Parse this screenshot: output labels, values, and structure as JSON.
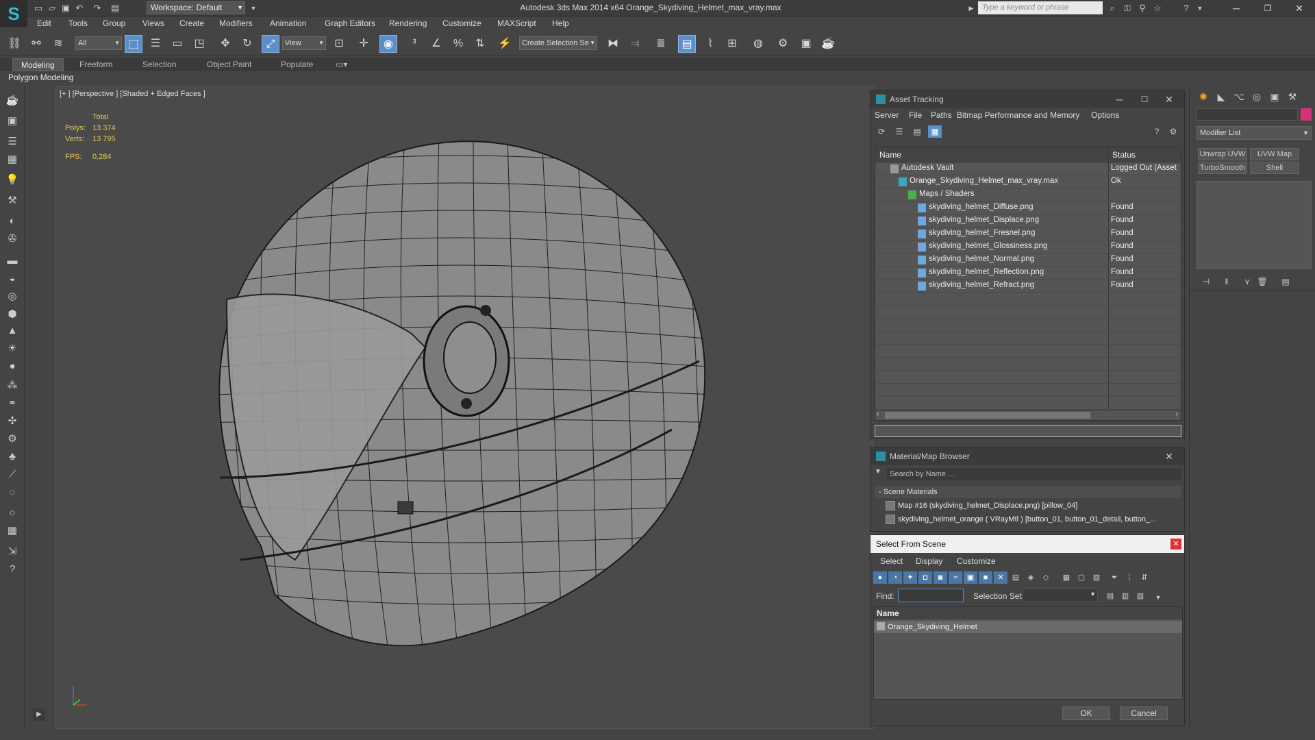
{
  "title": "Autodesk 3ds Max  2014 x64    Orange_Skydiving_Helmet_max_vray.max",
  "workspace": "Workspace: Default",
  "search_placeholder": "Type a keyword or phrase",
  "menu": [
    "Edit",
    "Tools",
    "Group",
    "Views",
    "Create",
    "Modifiers",
    "Animation",
    "Graph Editors",
    "Rendering",
    "Customize",
    "MAXScript",
    "Help"
  ],
  "toolbar": {
    "filter": "All",
    "refcoord": "View",
    "selset": "Create Selection Se"
  },
  "ribbon": {
    "tabs": [
      "Modeling",
      "Freeform",
      "Selection",
      "Object Paint",
      "Populate"
    ],
    "panel": "Polygon Modeling"
  },
  "viewport": {
    "label": "[+ ] [Perspective ] [Shaded + Edged Faces ]",
    "stats": {
      "total_label": "Total",
      "polys_label": "Polys:",
      "polys": "13 374",
      "verts_label": "Verts:",
      "verts": "13 795",
      "fps_label": "FPS:",
      "fps": "0,284"
    }
  },
  "asset_tracking": {
    "title": "Asset Tracking",
    "menu": [
      "Server",
      "File",
      "Paths",
      "Bitmap Performance and Memory",
      "Options"
    ],
    "columns": [
      "Name",
      "Status"
    ],
    "rows": [
      {
        "name": "Autodesk Vault",
        "status": "Logged Out (Asset"
      },
      {
        "name": "Orange_Skydiving_Helmet_max_vray.max",
        "status": "Ok"
      },
      {
        "name": "Maps / Shaders",
        "status": ""
      },
      {
        "name": "skydiving_helmet_Diffuse.png",
        "status": "Found"
      },
      {
        "name": "skydiving_helmet_Displace.png",
        "status": "Found"
      },
      {
        "name": "skydiving_helmet_Fresnel.png",
        "status": "Found"
      },
      {
        "name": "skydiving_helmet_Glossiness.png",
        "status": "Found"
      },
      {
        "name": "skydiving_helmet_Normal.png",
        "status": "Found"
      },
      {
        "name": "skydiving_helmet_Reflection.png",
        "status": "Found"
      },
      {
        "name": "skydiving_helmet_Refract.png",
        "status": "Found"
      }
    ]
  },
  "material_browser": {
    "title": "Material/Map Browser",
    "search": "Search by Name ...",
    "section": "- Scene Materials",
    "items": [
      "Map #16 (skydiving_helmet_Displace.png) [pillow_04]",
      "skydiving_helmet_orange ( VRayMtl ) [button_01, button_01_detail, button_..."
    ]
  },
  "select_from_scene": {
    "title": "Select From Scene",
    "menu": [
      "Select",
      "Display",
      "Customize"
    ],
    "find_label": "Find:",
    "selset_label": "Selection Set:",
    "column": "Name",
    "item": "Orange_Skydiving_Helmet",
    "ok": "OK",
    "cancel": "Cancel"
  },
  "command_panel": {
    "modifier_list": "Modifier List",
    "buttons": [
      "Unwrap UVW",
      "UVW Map",
      "TurboSmooth",
      "Shell"
    ]
  },
  "colors": {
    "accent": "#5b8fc9",
    "object_color": "#d6317a",
    "stats": "#e6c85a"
  }
}
